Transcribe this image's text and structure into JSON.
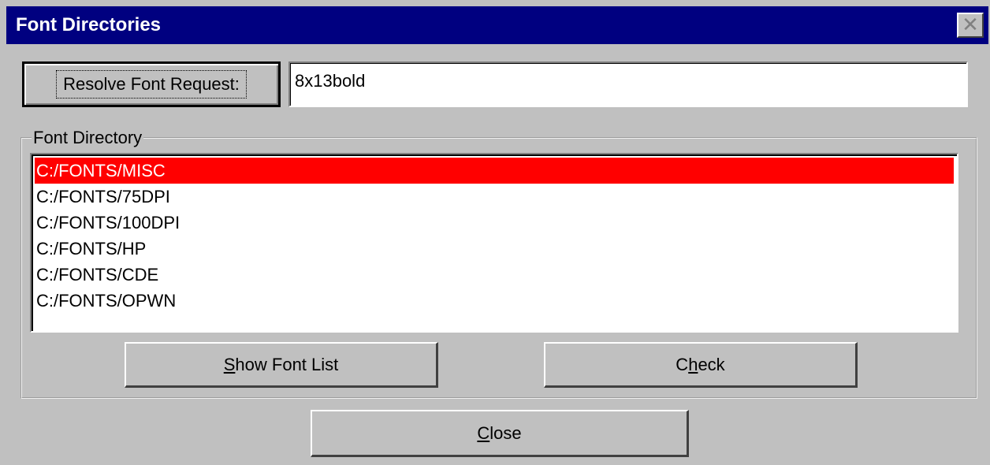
{
  "window": {
    "title": "Font Directories",
    "close_glyph": "✕"
  },
  "resolve": {
    "button_label": "Resolve Font Request:",
    "value": "8x13bold"
  },
  "font_directory": {
    "group_label": "Font Directory",
    "items": [
      "C:/FONTS/MISC",
      "C:/FONTS/75DPI",
      "C:/FONTS/100DPI",
      "C:/FONTS/HP",
      "C:/FONTS/CDE",
      "C:/FONTS/OPWN"
    ],
    "selected": "C:/FONTS/MISC",
    "selection_color": "#ff0000"
  },
  "buttons": {
    "show_font_list": {
      "mnemonic": "S",
      "rest": "how Font List"
    },
    "check": {
      "pre": "C",
      "mnemonic": "h",
      "rest": "eck"
    },
    "close": {
      "mnemonic": "C",
      "rest": "lose"
    }
  },
  "colors": {
    "titlebar": "#000080",
    "face": "#c0c0c0"
  }
}
